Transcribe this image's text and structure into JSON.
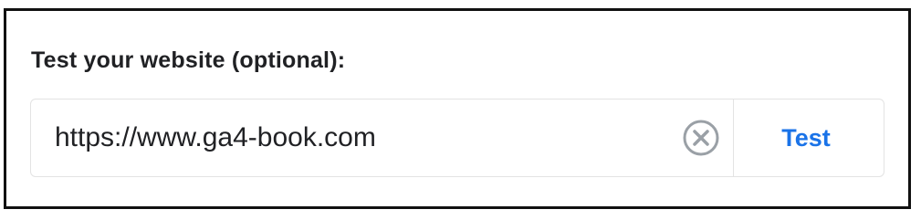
{
  "section": {
    "heading": "Test your website (optional):"
  },
  "url_field": {
    "value": "https://www.ga4-book.com",
    "clear_icon": "clear-circle-x-icon"
  },
  "test_button": {
    "label": "Test"
  },
  "colors": {
    "accent": "#1a73e8",
    "text": "#202124",
    "icon_gray": "#9aa0a6",
    "field_border": "#e3e3e3",
    "frame_border": "#111111"
  }
}
